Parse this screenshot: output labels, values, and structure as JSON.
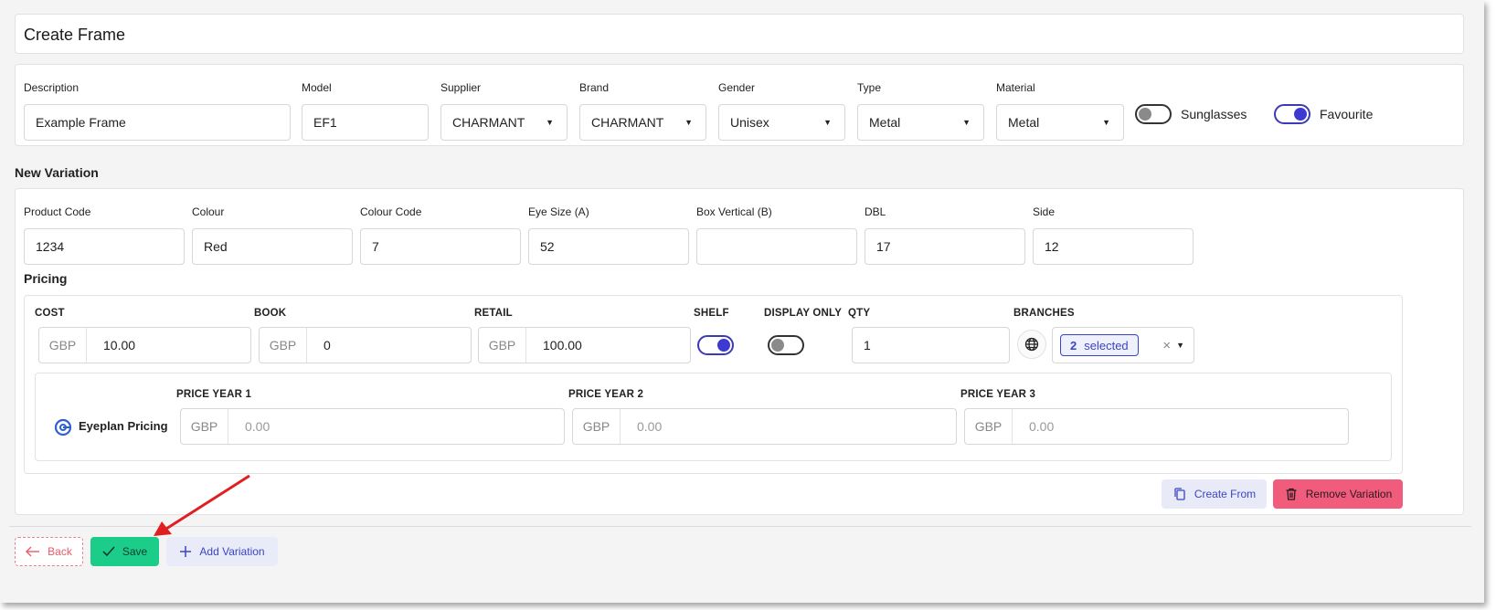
{
  "page": {
    "title": "Create Frame"
  },
  "frame": {
    "fields": {
      "description": {
        "label": "Description",
        "value": "Example Frame"
      },
      "model": {
        "label": "Model",
        "value": "EF1"
      },
      "supplier": {
        "label": "Supplier",
        "value": "CHARMANT"
      },
      "brand": {
        "label": "Brand",
        "value": "CHARMANT"
      },
      "gender": {
        "label": "Gender",
        "value": "Unisex"
      },
      "type": {
        "label": "Type",
        "value": "Metal"
      },
      "material": {
        "label": "Material",
        "value": "Metal"
      }
    },
    "toggles": {
      "sunglasses": {
        "label": "Sunglasses",
        "on": false
      },
      "favourite": {
        "label": "Favourite",
        "on": true
      }
    }
  },
  "variation": {
    "title": "New Variation",
    "fields": {
      "product_code": {
        "label": "Product Code",
        "value": "1234"
      },
      "colour": {
        "label": "Colour",
        "value": "Red"
      },
      "colour_code": {
        "label": "Colour Code",
        "value": "7"
      },
      "eye_size": {
        "label": "Eye Size (A)",
        "value": "52"
      },
      "box_vertical": {
        "label": "Box Vertical (B)",
        "value": ""
      },
      "dbl": {
        "label": "DBL",
        "value": "17"
      },
      "side": {
        "label": "Side",
        "value": "12"
      }
    }
  },
  "pricing": {
    "title": "Pricing",
    "currency": "GBP",
    "cost": {
      "label": "COST",
      "value": "10.00"
    },
    "book": {
      "label": "BOOK",
      "value": "0"
    },
    "retail": {
      "label": "RETAIL",
      "value": "100.00"
    },
    "shelf": {
      "label": "SHELF",
      "on": true
    },
    "display_only": {
      "label": "DISPLAY ONLY",
      "on": false
    },
    "qty": {
      "label": "QTY",
      "value": "1"
    },
    "branches": {
      "label": "BRANCHES",
      "count": "2",
      "selected_text": "selected",
      "clear": "×"
    },
    "eyeplan": {
      "label": "Eyeplan Pricing",
      "year1": {
        "label": "PRICE YEAR 1",
        "placeholder": "0.00"
      },
      "year2": {
        "label": "PRICE YEAR 2",
        "placeholder": "0.00"
      },
      "year3": {
        "label": "PRICE YEAR 3",
        "placeholder": "0.00"
      }
    }
  },
  "actions": {
    "create_from": "Create From",
    "remove_variation": "Remove Variation",
    "back": "Back",
    "save": "Save",
    "add_variation": "Add Variation"
  },
  "colors": {
    "accent": "#3b45c4",
    "save": "#1ccd8a",
    "danger": "#f25c7c",
    "annotation_arrow": "#e02020"
  },
  "icons": [
    "chevron-down-icon",
    "globe-icon",
    "eyeplan-logo-icon",
    "copy-icon",
    "trash-icon",
    "arrow-left-icon",
    "check-icon",
    "plus-icon",
    "annotation-arrow"
  ]
}
